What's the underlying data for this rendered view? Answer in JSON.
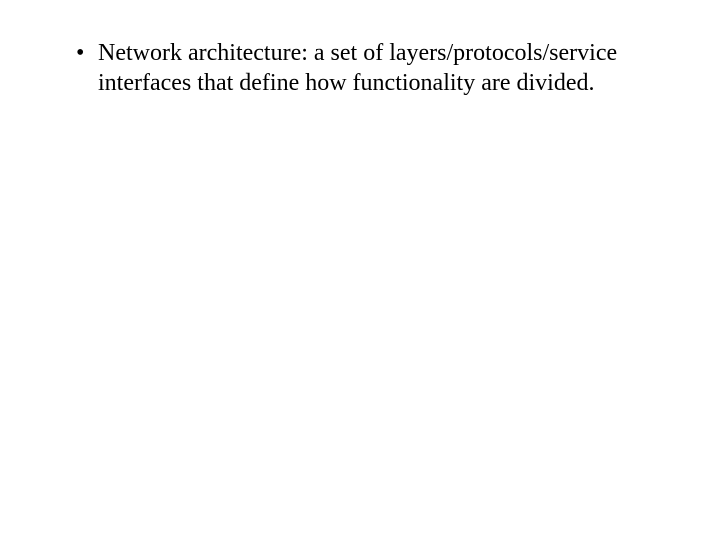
{
  "slide": {
    "bullets": [
      {
        "text": "Network architecture: a set of layers/protocols/service interfaces that define how functionality are divided."
      }
    ]
  }
}
